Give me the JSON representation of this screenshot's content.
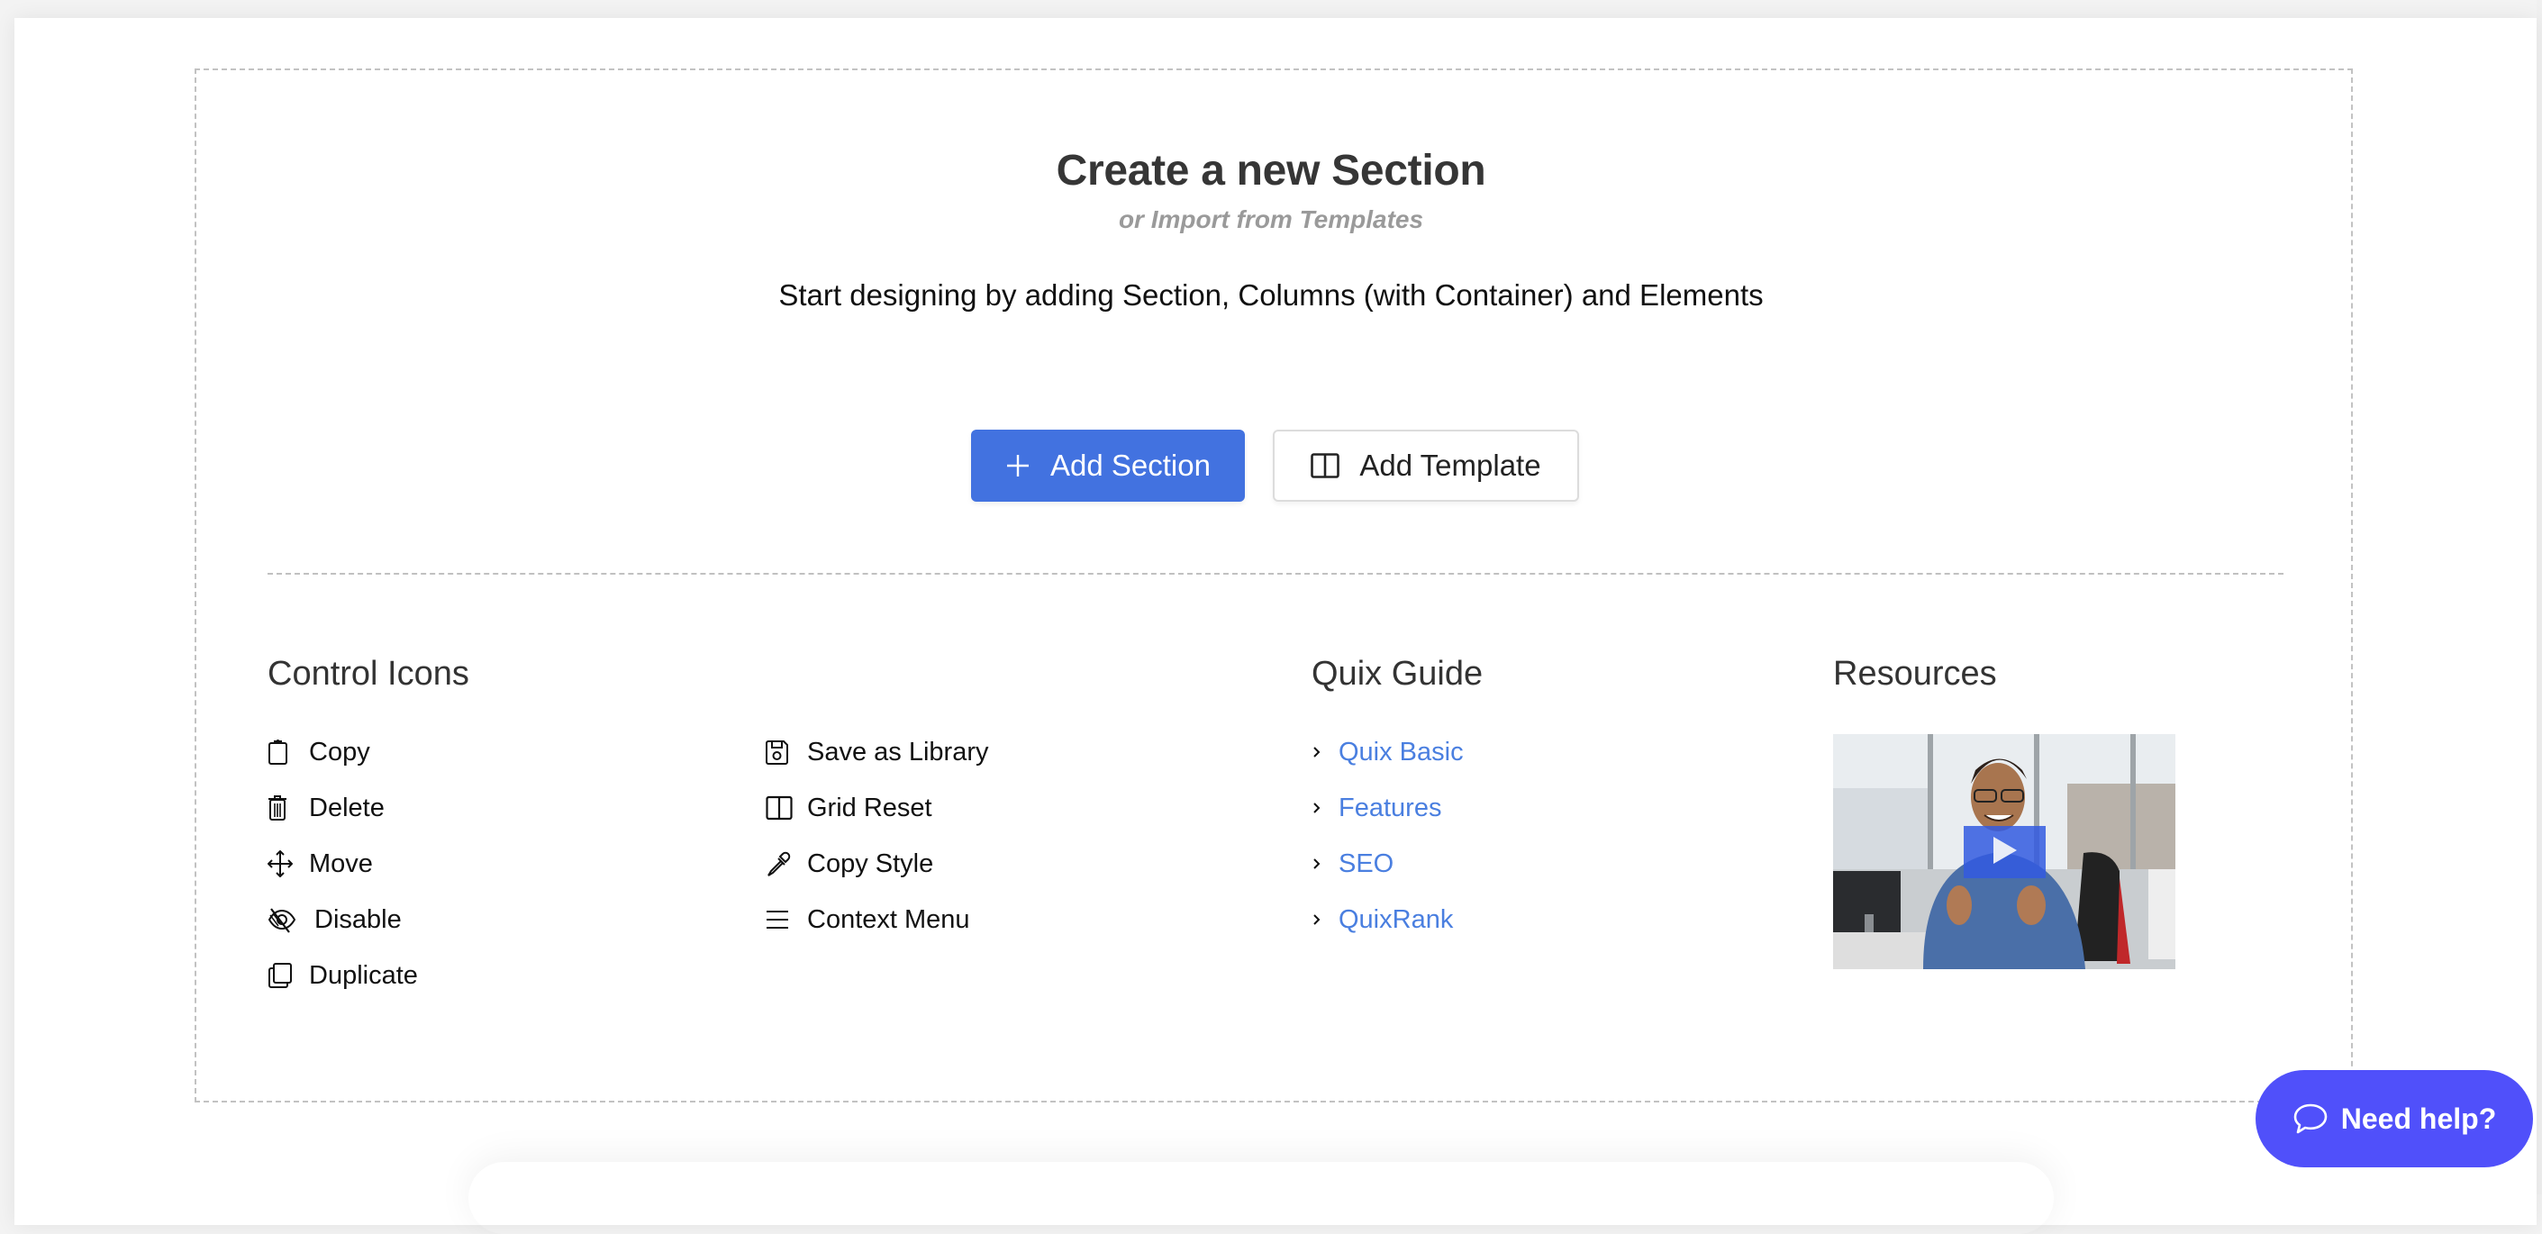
{
  "header": {
    "title": "Create a new Section",
    "subtitle": "or Import from Templates",
    "description": "Start designing by adding Section, Columns (with Container) and Elements"
  },
  "actions": {
    "add_section_label": "Add Section",
    "add_section_icon": "plus-icon",
    "add_template_label": "Add Template",
    "add_template_icon": "columns-icon"
  },
  "control_icons": {
    "heading": "Control Icons",
    "column1": [
      {
        "label": "Copy",
        "icon": "clipboard-icon"
      },
      {
        "label": "Delete",
        "icon": "trash-icon"
      },
      {
        "label": "Move",
        "icon": "move-arrows-icon"
      },
      {
        "label": "Disable",
        "icon": "eye-slash-icon"
      },
      {
        "label": "Duplicate",
        "icon": "duplicate-icon"
      }
    ],
    "column2": [
      {
        "label": "Save as Library",
        "icon": "floppy-disk-icon"
      },
      {
        "label": "Grid Reset",
        "icon": "columns-icon"
      },
      {
        "label": "Copy Style",
        "icon": "eyedropper-icon"
      },
      {
        "label": "Context Menu",
        "icon": "hamburger-menu-icon"
      }
    ]
  },
  "quix_guide": {
    "heading": "Quix Guide",
    "links": [
      {
        "label": "Quix Basic"
      },
      {
        "label": "Features"
      },
      {
        "label": "SEO"
      },
      {
        "label": "QuixRank"
      }
    ]
  },
  "resources": {
    "heading": "Resources",
    "video_icon": "play-icon"
  },
  "help": {
    "label": "Need help?",
    "icon": "chat-bubble-icon"
  },
  "colors": {
    "primary": "#4272e0",
    "link": "#4a7fe0",
    "help_button": "#5050fa",
    "title": "#363636",
    "subtitle": "#9a9a9a"
  }
}
